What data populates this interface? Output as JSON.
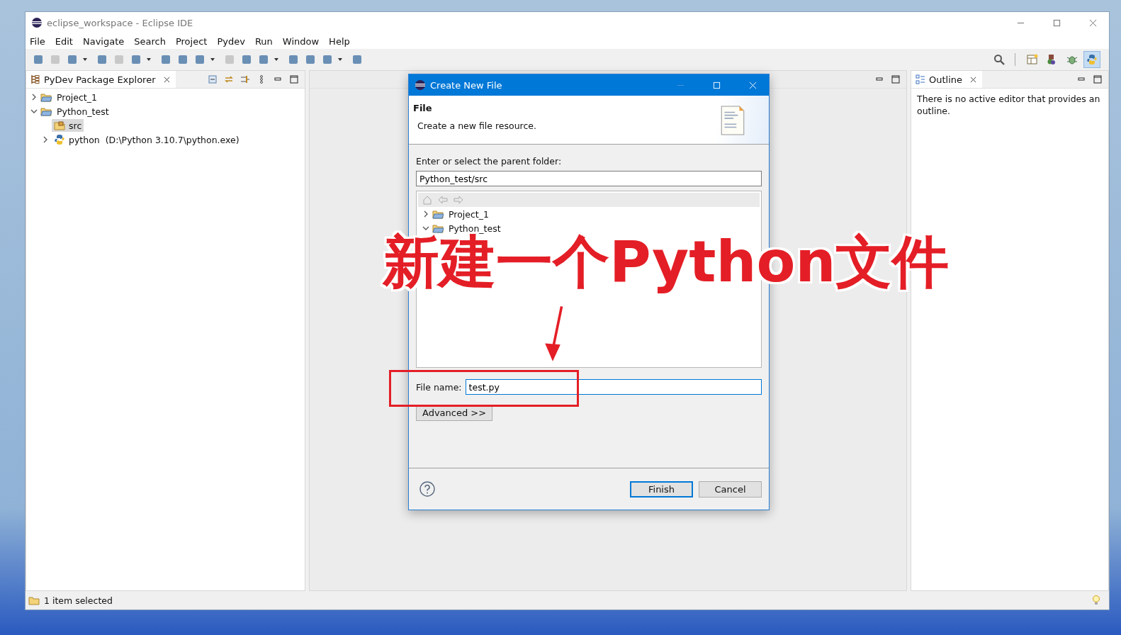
{
  "window": {
    "title": "eclipse_workspace - Eclipse IDE"
  },
  "menu": [
    "File",
    "Edit",
    "Navigate",
    "Search",
    "Project",
    "Pydev",
    "Run",
    "Window",
    "Help"
  ],
  "perspectives": [
    {
      "kind": "open",
      "selected": false
    },
    {
      "kind": "java",
      "selected": false
    },
    {
      "kind": "debug",
      "selected": false
    },
    {
      "kind": "python",
      "selected": true
    }
  ],
  "explorer": {
    "title": "PyDev Package Explorer",
    "tree": [
      {
        "label": "Project_1",
        "expanded": false,
        "selected": false
      },
      {
        "label": "Python_test",
        "expanded": true,
        "selected": false,
        "children": [
          {
            "label": "src",
            "kind": "folder",
            "selected": true
          },
          {
            "label": "python  (D:\\Python 3.10.7\\python.exe)",
            "kind": "interpreter",
            "expanded": false,
            "selected": false
          }
        ]
      }
    ]
  },
  "outline": {
    "title": "Outline",
    "message": "There is no active editor that provides an outline."
  },
  "status_bar": {
    "text": "1 item selected"
  },
  "dialog": {
    "title": "Create New File",
    "heading": "File",
    "description": "Create a new file resource.",
    "parent_label": "Enter or select the parent folder:",
    "parent_value": "Python_test/src",
    "tree": [
      {
        "label": "Project_1",
        "expanded": false
      },
      {
        "label": "Python_test",
        "expanded": true
      }
    ],
    "file_name_label": "File name:",
    "file_name_value": "test.py",
    "advanced_button": "Advanced >>",
    "buttons": [
      {
        "label": "Finish",
        "default": true
      },
      {
        "label": "Cancel",
        "default": false
      }
    ]
  },
  "annotation": {
    "text": "新建一个Python文件"
  }
}
